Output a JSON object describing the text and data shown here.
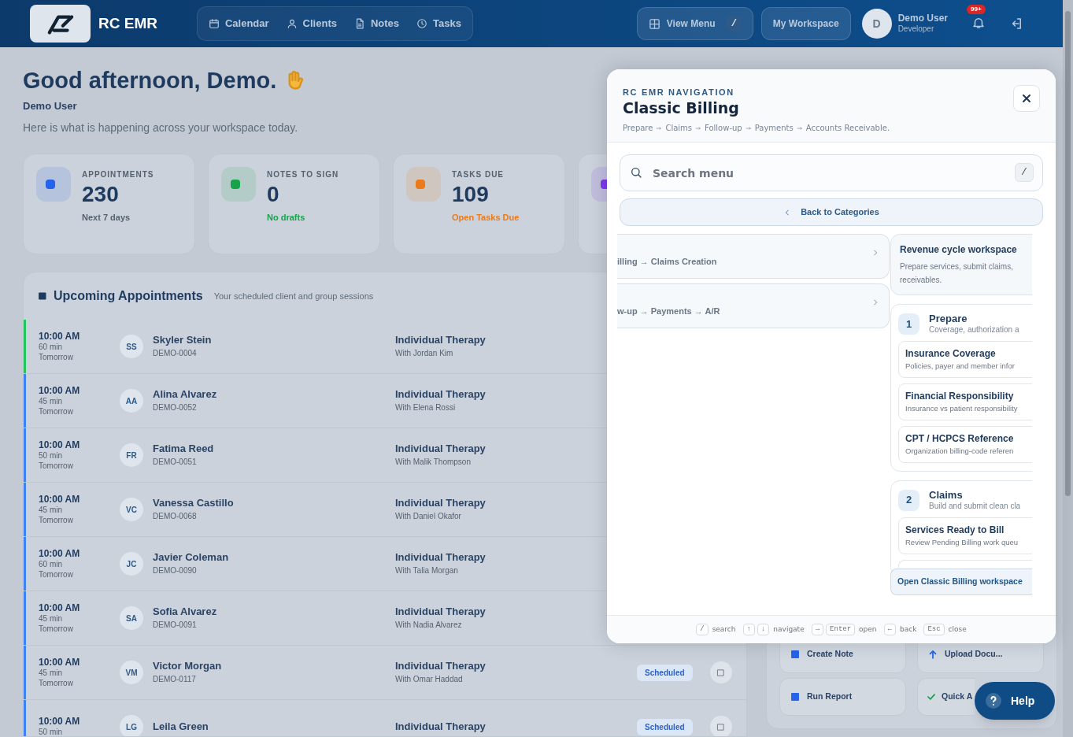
{
  "header": {
    "logo_text": "RC EMR",
    "nav": [
      {
        "label": "Calendar"
      },
      {
        "label": "Clients"
      },
      {
        "label": "Notes"
      },
      {
        "label": "Tasks"
      }
    ],
    "view_menu": {
      "label": "View Menu",
      "shortcut": "/"
    },
    "workspace_button": "My Workspace",
    "user": {
      "initial": "D",
      "name": "Demo User",
      "role": "Developer"
    },
    "notification_badge": "99+"
  },
  "dashboard": {
    "greeting": "Good afternoon, Demo.",
    "user_name": "Demo User",
    "subtitle": "Here is what is happening across your workspace today.",
    "stats": [
      {
        "label": "APPOINTMENTS",
        "value": "230",
        "note": "Next 7 days",
        "color": "#2563eb"
      },
      {
        "label": "NOTES TO SIGN",
        "value": "0",
        "note": "No drafts",
        "color": "#16a34a"
      },
      {
        "label": "TASKS DUE",
        "value": "109",
        "note": "Open Tasks Due",
        "color": "#ea7a1a"
      },
      {
        "color": "#7c3aed"
      }
    ],
    "appointments": {
      "title": "Upcoming Appointments",
      "subtitle": "Your scheduled client and group sessions",
      "rows": [
        {
          "time": "10:00 AM",
          "duration": "60 min",
          "day": "Tomorrow",
          "initials": "SS",
          "name": "Skyler Stein",
          "client_id": "DEMO-0004",
          "service": "Individual Therapy",
          "clinician": "With Jordan Kim",
          "color": "#22c55e"
        },
        {
          "time": "10:00 AM",
          "duration": "45 min",
          "day": "Tomorrow",
          "initials": "AA",
          "name": "Alina Alvarez",
          "client_id": "DEMO-0052",
          "service": "Individual Therapy",
          "clinician": "With Elena Rossi",
          "color": "#3b82f6"
        },
        {
          "time": "10:00 AM",
          "duration": "50 min",
          "day": "Tomorrow",
          "initials": "FR",
          "name": "Fatima Reed",
          "client_id": "DEMO-0051",
          "service": "Individual Therapy",
          "clinician": "With Malik Thompson",
          "color": "#3b82f6"
        },
        {
          "time": "10:00 AM",
          "duration": "45 min",
          "day": "Tomorrow",
          "initials": "VC",
          "name": "Vanessa Castillo",
          "client_id": "DEMO-0068",
          "service": "Individual Therapy",
          "clinician": "With Daniel Okafor",
          "color": "#3b82f6"
        },
        {
          "time": "10:00 AM",
          "duration": "60 min",
          "day": "Tomorrow",
          "initials": "JC",
          "name": "Javier Coleman",
          "client_id": "DEMO-0090",
          "service": "Individual Therapy",
          "clinician": "With Talia Morgan",
          "color": "#3b82f6"
        },
        {
          "time": "10:00 AM",
          "duration": "45 min",
          "day": "Tomorrow",
          "initials": "SA",
          "name": "Sofia Alvarez",
          "client_id": "DEMO-0091",
          "service": "Individual Therapy",
          "clinician": "With Nadia Alvarez",
          "color": "#3b82f6"
        },
        {
          "time": "10:00 AM",
          "duration": "45 min",
          "day": "Tomorrow",
          "initials": "VM",
          "name": "Victor Morgan",
          "client_id": "DEMO-0117",
          "service": "Individual Therapy",
          "clinician": "With Omar Haddad",
          "status": "Scheduled",
          "color": "#3b82f6"
        },
        {
          "time": "10:00 AM",
          "duration": "50 min",
          "initials": "LG",
          "name": "Leila Green",
          "service": "Individual Therapy",
          "status": "Scheduled",
          "color": "#3b82f6"
        }
      ]
    },
    "quick_actions": [
      {
        "label": "Create Note",
        "color": "#2563eb"
      },
      {
        "label": "Upload Docu...",
        "color": "#2563eb"
      },
      {
        "label": "Run Report",
        "color": "#2563eb"
      },
      {
        "label": "Quick A",
        "color": "#16a34a"
      }
    ],
    "help_button": "Help"
  },
  "modal": {
    "eyebrow": "RC EMR NAVIGATION",
    "title": "Classic Billing",
    "breadcrumb": [
      "Prepare",
      "Claims",
      "Follow-up",
      "Payments",
      "Accounts Receivable."
    ],
    "search": {
      "placeholder": "Search menu",
      "shortcut": "/"
    },
    "back_button": "Back to Categories",
    "routes": [
      {
        "path": "illing → Claims Creation"
      },
      {
        "path": "w-up → Payments → A/R"
      }
    ],
    "overview": {
      "title": "Revenue cycle workspace",
      "lines": [
        "Prepare services, submit claims,",
        "receivables."
      ]
    },
    "steps": [
      {
        "number": "1",
        "title": "Prepare",
        "subtitle": "Coverage, authorization a",
        "items": [
          {
            "title": "Insurance Coverage",
            "description": "Policies, payer and member infor"
          },
          {
            "title": "Financial Responsibility",
            "description": "Insurance vs patient responsibility"
          },
          {
            "title": "CPT / HCPCS Reference",
            "description": "Organization billing-code referen"
          }
        ]
      },
      {
        "number": "2",
        "title": "Claims",
        "subtitle": "Build and submit clean cla",
        "items": [
          {
            "title": "Services Ready to Bill",
            "description": "Review Pending Billing work queu"
          }
        ]
      }
    ],
    "open_button": "Open Classic Billing workspace",
    "hints": [
      {
        "keys": [
          "/"
        ],
        "label": "search"
      },
      {
        "keys": [
          "↑",
          "↓"
        ],
        "label": "navigate"
      },
      {
        "keys": [
          "→",
          "Enter"
        ],
        "label": "open"
      },
      {
        "keys": [
          "←"
        ],
        "label": "back"
      },
      {
        "keys": [
          "Esc"
        ],
        "label": "close"
      }
    ]
  }
}
